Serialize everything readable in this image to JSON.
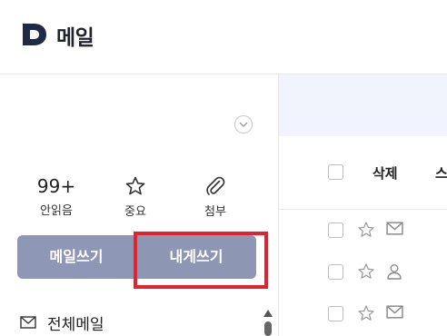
{
  "header": {
    "app_title": "메일",
    "logo_icon": "daum-d-logo",
    "brand_color": "#1f2a44"
  },
  "sidebar": {
    "collapse_icon": "chevron-down-icon",
    "quick": {
      "unread_count": "99+",
      "unread_label": "안읽음",
      "important_label": "중요",
      "attach_label": "첨부"
    },
    "compose": {
      "write_label": "메일쓰기",
      "self_label": "내게쓰기",
      "button_color": "#8e97b5"
    },
    "folders": [
      {
        "label": "전체메일",
        "icon": "mail-icon"
      }
    ]
  },
  "toolbar": {
    "delete_label": "삭제",
    "spam_label": "스"
  },
  "rows": [
    {
      "icon": "mail-icon"
    },
    {
      "icon": "person-icon"
    },
    {
      "icon": "mail-icon"
    }
  ],
  "highlight_color": "#e0232e"
}
